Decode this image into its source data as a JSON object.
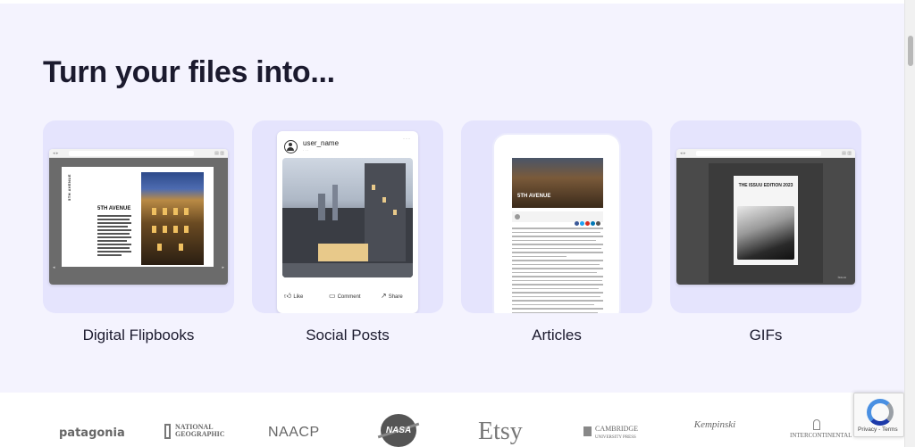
{
  "hero": {
    "heading": "Turn your files into...",
    "cards": [
      {
        "label": "Digital Flipbooks"
      },
      {
        "label": "Social Posts"
      },
      {
        "label": "Articles"
      },
      {
        "label": "GIFs"
      }
    ]
  },
  "flipbook": {
    "vertical_text": "5TH AVENUE",
    "page_title": "5TH AVENUE"
  },
  "social_post": {
    "username": "user_name",
    "like": "Like",
    "comment": "Comment",
    "share": "Share"
  },
  "article": {
    "photo_title": "5TH AVENUE"
  },
  "gif": {
    "book_title": "THE ISSUU EDITION 2023",
    "watermark": "issuu"
  },
  "logos": {
    "patagonia": "patagonia",
    "natgeo": [
      "NATIONAL",
      "GEOGRAPHIC"
    ],
    "naacp": "NAACP",
    "nasa": "NASA",
    "etsy": "Etsy",
    "cambridge": [
      "CAMBRIDGE",
      "UNIVERSITY PRESS"
    ],
    "kempinski": "Kempinski",
    "intercontinental": "INTERCONTINENTAL"
  },
  "recaptcha": {
    "links": "Privacy - Terms"
  },
  "colors": {
    "hero_bg": "#f4f3fe",
    "card_bg": "#e5e4fd",
    "heading": "#1b1a2e"
  }
}
